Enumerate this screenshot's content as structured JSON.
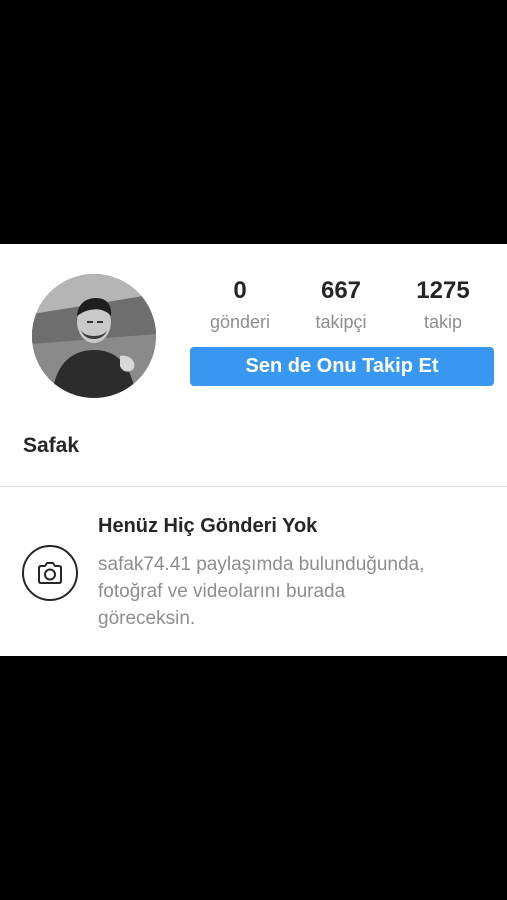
{
  "profile": {
    "username": "Safak",
    "stats": [
      {
        "value": "0",
        "label": "gönderi"
      },
      {
        "value": "667",
        "label": "takipçi"
      },
      {
        "value": "1275",
        "label": "takip"
      }
    ],
    "follow_button_label": "Sen de Onu Takip Et"
  },
  "empty_posts": {
    "icon": "camera-icon",
    "title": "Henüz Hiç Gönderi Yok",
    "description_lines": [
      "safak74.41 paylaşımda bulunduğunda,",
      "fotoğraf ve videolarını burada",
      "göreceksin."
    ]
  },
  "colors": {
    "accent": "#3897f0",
    "text_primary": "#262626",
    "text_secondary": "#8e8e8e",
    "letterbox": "#000000"
  }
}
